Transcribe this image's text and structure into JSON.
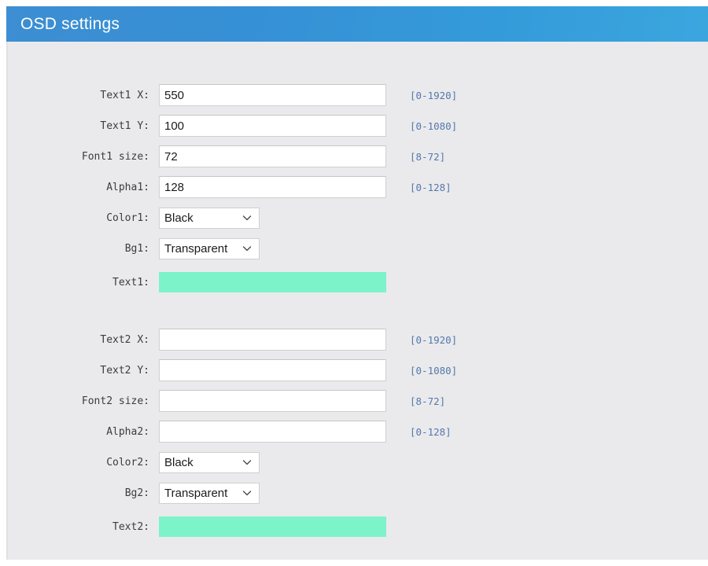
{
  "header": {
    "title": "OSD settings",
    "accent_color_left": "#3d8ed2",
    "accent_color_right": "#3ba6de"
  },
  "body": {
    "background_color": "#eaeaec",
    "highlight_field_color": "#7df3ca",
    "hint_color": "#5478ad"
  },
  "groups": [
    {
      "name": "text1-group",
      "rows": [
        {
          "name": "text1-x",
          "label": "Text1 X:",
          "type": "input",
          "value": "550",
          "placeholder": "",
          "hint": "[0-1920]"
        },
        {
          "name": "text1-y",
          "label": "Text1 Y:",
          "type": "input",
          "value": "100",
          "placeholder": "",
          "hint": "[0-1080]"
        },
        {
          "name": "font1-size",
          "label": "Font1 size:",
          "type": "input",
          "value": "72",
          "placeholder": "",
          "hint": "[8-72]"
        },
        {
          "name": "alpha1",
          "label": "Alpha1:",
          "type": "input",
          "value": "128",
          "placeholder": "",
          "hint": "[0-128]"
        },
        {
          "name": "color1",
          "label": "Color1:",
          "type": "select",
          "value": "Black",
          "hint": ""
        },
        {
          "name": "bg1",
          "label": "Bg1:",
          "type": "select",
          "value": "Transparent",
          "hint": ""
        },
        {
          "name": "text1",
          "label": "Text1:",
          "type": "textcolor",
          "value": "",
          "placeholder": "",
          "hint": ""
        }
      ]
    },
    {
      "name": "text2-group",
      "rows": [
        {
          "name": "text2-x",
          "label": "Text2 X:",
          "type": "input",
          "value": "",
          "placeholder": "",
          "hint": "[0-1920]"
        },
        {
          "name": "text2-y",
          "label": "Text2 Y:",
          "type": "input",
          "value": "",
          "placeholder": "",
          "hint": "[0-1080]"
        },
        {
          "name": "font2-size",
          "label": "Font2 size:",
          "type": "input",
          "value": "",
          "placeholder": "",
          "hint": "[8-72]"
        },
        {
          "name": "alpha2",
          "label": "Alpha2:",
          "type": "input",
          "value": "",
          "placeholder": "",
          "hint": "[0-128]"
        },
        {
          "name": "color2",
          "label": "Color2:",
          "type": "select",
          "value": "Black",
          "hint": ""
        },
        {
          "name": "bg2",
          "label": "Bg2:",
          "type": "select",
          "value": "Transparent",
          "hint": ""
        },
        {
          "name": "text2",
          "label": "Text2:",
          "type": "textcolor",
          "value": "",
          "placeholder": "",
          "hint": ""
        }
      ]
    }
  ],
  "icons": {
    "chevron_down": "chevron-down-icon",
    "header_pointer": "triangle-pointer-icon"
  }
}
